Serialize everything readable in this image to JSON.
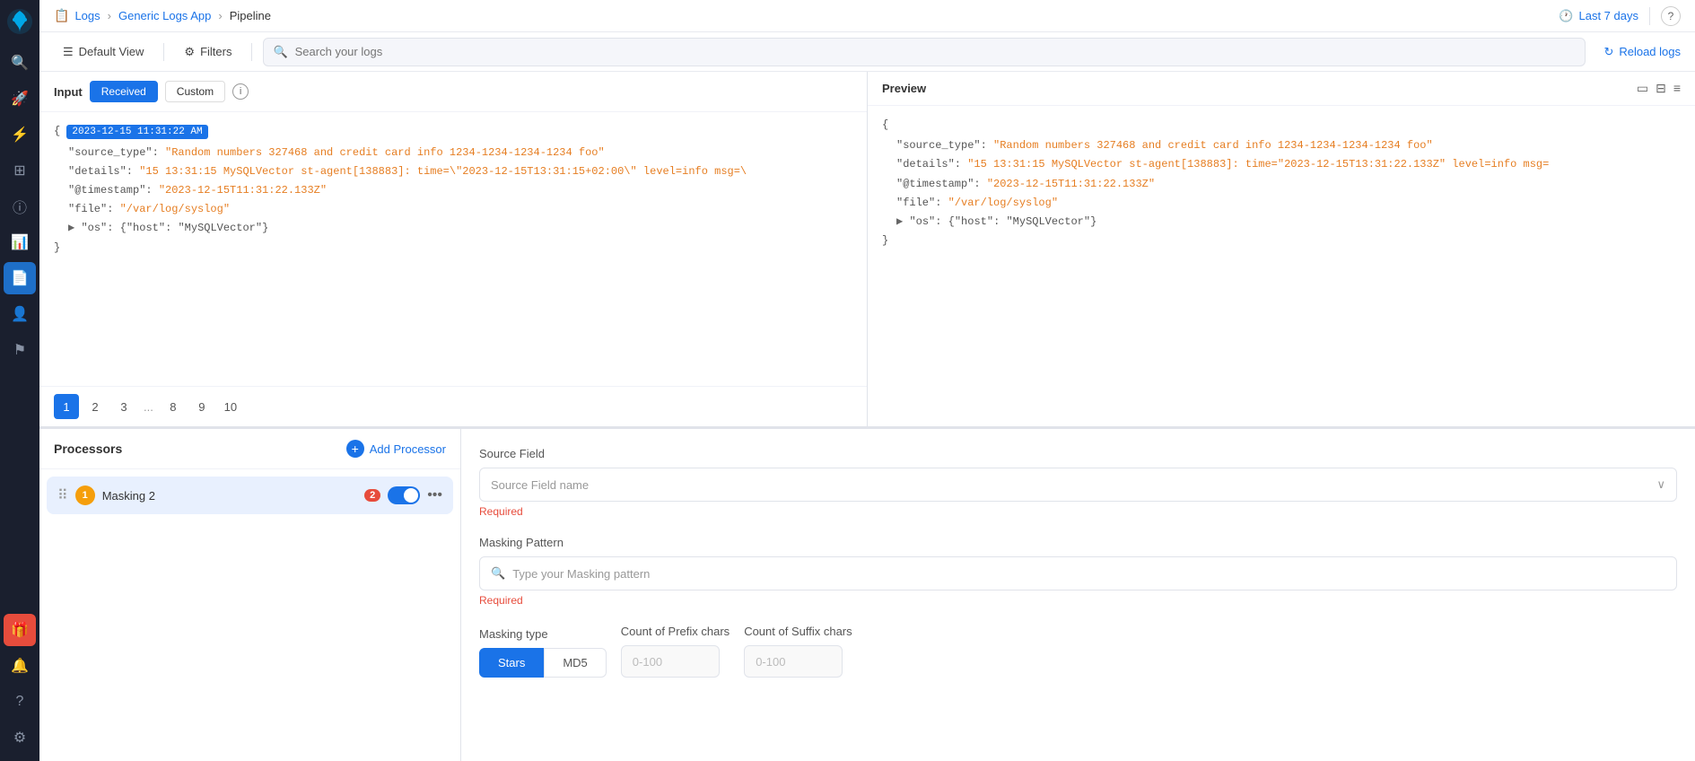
{
  "sidebar": {
    "icons": [
      "search",
      "rocket",
      "layer",
      "grid",
      "alert-circle",
      "bar-chart",
      "document",
      "person",
      "flag",
      "bell",
      "help",
      "settings"
    ]
  },
  "topbar": {
    "breadcrumb": {
      "logs": "Logs",
      "app": "Generic Logs App",
      "current": "Pipeline"
    },
    "time_range": "Last 7 days",
    "help_label": "?"
  },
  "toolbar": {
    "default_view": "Default View",
    "filters": "Filters",
    "search_placeholder": "Search your logs",
    "reload": "Reload logs"
  },
  "input_panel": {
    "title": "Input",
    "tab_received": "Received",
    "tab_custom": "Custom",
    "info_icon": "i",
    "timestamp": "2023-12-15 11:31:22 AM",
    "code_lines": [
      "{ ",
      "  \"source_type\": \"Random numbers 327468 and credit card info 1234-1234-1234-1234 foo\"",
      "  \"details\": \"15 13:31:15 MySQLVector st-agent[138883]: time=\\\"2023-12-15T13:31:15+02:00\\\" level=info msg=\\",
      "  \"@timestamp\": \"2023-12-15T11:31:22.133Z\"",
      "  \"file\": \"/var/log/syslog\"",
      "  ▶ \"os\": {\"host\": \"MySQLVector\"}",
      "}"
    ],
    "pagination": {
      "pages": [
        "1",
        "2",
        "3",
        "...",
        "8",
        "9",
        "10"
      ],
      "active": "1"
    }
  },
  "preview_panel": {
    "title": "Preview",
    "code_lines": [
      "{",
      "  \"source_type\": \"Random numbers 327468 and credit card info 1234-1234-1234-1234 foo\"",
      "  \"details\": \"15 13:31:15 MySQLVector st-agent[138883]: time=\\\"2023-12-15T13:31:22.133Z\\\" level=info msg=",
      "  \"@timestamp\": \"2023-12-15T11:31:22.133Z\"",
      "  \"file\": \"/var/log/syslog\"",
      "  ▶ \"os\": {\"host\": \"MySQLVector\"}",
      "}"
    ]
  },
  "processors": {
    "title": "Processors",
    "add_label": "Add Processor",
    "items": [
      {
        "num": "1",
        "name": "Masking 2",
        "badge": "2",
        "enabled": true
      }
    ]
  },
  "config": {
    "source_field_label": "Source Field",
    "source_field_placeholder": "Source Field name",
    "source_required": "Required",
    "masking_pattern_label": "Masking Pattern",
    "masking_pattern_placeholder": "Type your Masking pattern",
    "masking_required": "Required",
    "masking_type_label": "Masking type",
    "masking_type_options": [
      "Stars",
      "MD5"
    ],
    "masking_type_active": "Stars",
    "prefix_chars_label": "Count of Prefix chars",
    "prefix_placeholder": "0-100",
    "suffix_chars_label": "Count of Suffix chars",
    "suffix_placeholder": "0-100"
  }
}
